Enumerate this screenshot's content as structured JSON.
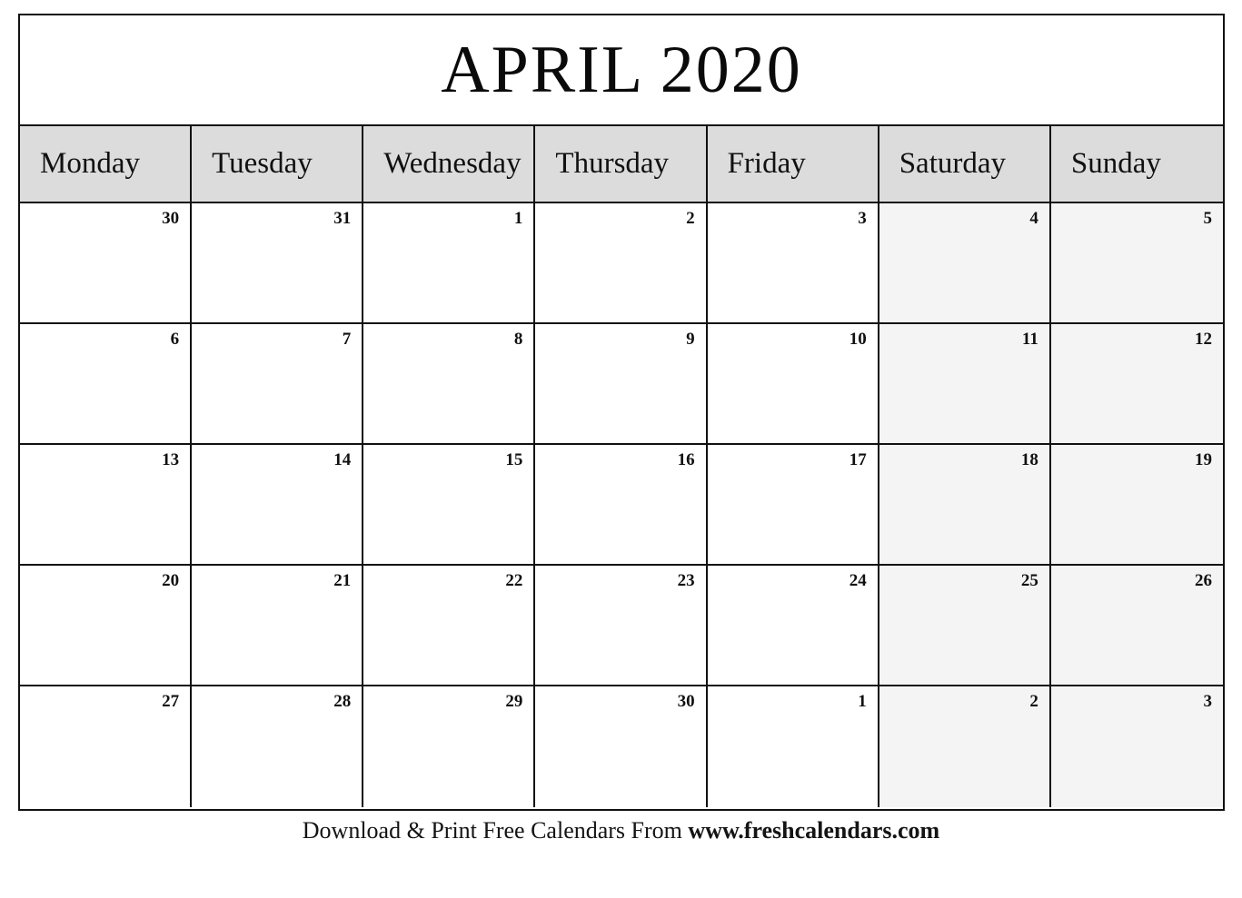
{
  "calendar": {
    "title": "APRIL 2020",
    "month": "APRIL",
    "year": "2020",
    "weekday_headers": [
      "Monday",
      "Tuesday",
      "Wednesday",
      "Thursday",
      "Friday",
      "Saturday",
      "Sunday"
    ],
    "weekend_columns": [
      5,
      6
    ],
    "weeks": [
      {
        "days": [
          {
            "num": "30",
            "in_month": false
          },
          {
            "num": "31",
            "in_month": false
          },
          {
            "num": "1",
            "in_month": true
          },
          {
            "num": "2",
            "in_month": true
          },
          {
            "num": "3",
            "in_month": true
          },
          {
            "num": "4",
            "in_month": true
          },
          {
            "num": "5",
            "in_month": true
          }
        ]
      },
      {
        "days": [
          {
            "num": "6",
            "in_month": true
          },
          {
            "num": "7",
            "in_month": true
          },
          {
            "num": "8",
            "in_month": true
          },
          {
            "num": "9",
            "in_month": true
          },
          {
            "num": "10",
            "in_month": true
          },
          {
            "num": "11",
            "in_month": true
          },
          {
            "num": "12",
            "in_month": true
          }
        ]
      },
      {
        "days": [
          {
            "num": "13",
            "in_month": true
          },
          {
            "num": "14",
            "in_month": true
          },
          {
            "num": "15",
            "in_month": true
          },
          {
            "num": "16",
            "in_month": true
          },
          {
            "num": "17",
            "in_month": true
          },
          {
            "num": "18",
            "in_month": true
          },
          {
            "num": "19",
            "in_month": true
          }
        ]
      },
      {
        "days": [
          {
            "num": "20",
            "in_month": true
          },
          {
            "num": "21",
            "in_month": true
          },
          {
            "num": "22",
            "in_month": true
          },
          {
            "num": "23",
            "in_month": true
          },
          {
            "num": "24",
            "in_month": true
          },
          {
            "num": "25",
            "in_month": true
          },
          {
            "num": "26",
            "in_month": true
          }
        ]
      },
      {
        "days": [
          {
            "num": "27",
            "in_month": true
          },
          {
            "num": "28",
            "in_month": true
          },
          {
            "num": "29",
            "in_month": true
          },
          {
            "num": "30",
            "in_month": true
          },
          {
            "num": "1",
            "in_month": false
          },
          {
            "num": "2",
            "in_month": false
          },
          {
            "num": "3",
            "in_month": false
          }
        ]
      }
    ],
    "colors": {
      "header_background": "#dcdcdc",
      "weekend_background": "#f4f4f4",
      "weekday_background": "#ffffff",
      "border": "#111111",
      "text": "#101010",
      "page_background": "#ffffff"
    }
  },
  "footer": {
    "text_plain": "Download & Print Free Calendars From ",
    "text_bold": "www.freshcalendars.com"
  }
}
